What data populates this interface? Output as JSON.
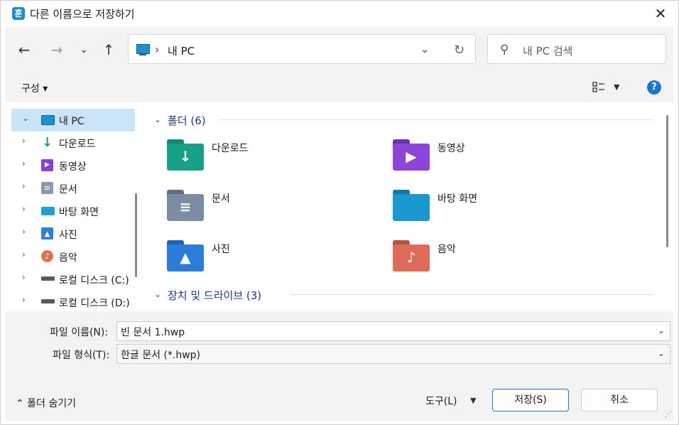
{
  "window": {
    "app_icon": "훈",
    "title": "다른 이름으로 저장하기",
    "close_glyph": "✕"
  },
  "nav": {
    "back": "←",
    "forward": "→",
    "recent": "⌄",
    "up": "↑",
    "address_sep": "›",
    "address": "내 PC",
    "address_dd": "⌄",
    "refresh": "↻",
    "search_placeholder": "내 PC 검색"
  },
  "toolbar": {
    "organize": "구성 ▾",
    "view_dd": "▼",
    "help": "?"
  },
  "tree": [
    {
      "label": "내 PC",
      "chev": "⌄",
      "icon": "pc-icon",
      "color": "#1e90cf",
      "selected": true
    },
    {
      "label": "다운로드",
      "chev": "›",
      "icon": "download-icon",
      "color": "#1aa37a"
    },
    {
      "label": "동영상",
      "chev": "›",
      "icon": "video-icon",
      "color": "#8a3fd6"
    },
    {
      "label": "문서",
      "chev": "›",
      "icon": "document-icon",
      "color": "#8a99ad"
    },
    {
      "label": "바탕 화면",
      "chev": "›",
      "icon": "desktop-icon",
      "color": "#1aa0d6"
    },
    {
      "label": "사진",
      "chev": "›",
      "icon": "photo-icon",
      "color": "#2f7dd6"
    },
    {
      "label": "음악",
      "chev": "›",
      "icon": "music-icon",
      "color": "#e0705a"
    },
    {
      "label": "로컬 디스크 (C:)",
      "chev": "›",
      "icon": "drive-c-icon",
      "color": "#5a5a5a"
    },
    {
      "label": "로컬 디스크 (D:)",
      "chev": "›",
      "icon": "drive-d-icon",
      "color": "#5a5a5a"
    }
  ],
  "groups": {
    "folders": {
      "label": "폴더 (6)"
    },
    "drives": {
      "label": "장치 및 드라이브 (3)"
    }
  },
  "folders": [
    {
      "label": "다운로드",
      "icon": "download-folder-icon",
      "color": "#17a085",
      "glyph": "↓"
    },
    {
      "label": "동영상",
      "icon": "video-folder-icon",
      "color": "#8e44d9",
      "glyph": "▶"
    },
    {
      "label": "문서",
      "icon": "document-folder-icon",
      "color": "#7b8ca3",
      "glyph": "≡"
    },
    {
      "label": "바탕 화면",
      "icon": "desktop-folder-icon",
      "color": "#1a98d0",
      "glyph": ""
    },
    {
      "label": "사진",
      "icon": "photo-folder-icon",
      "color": "#2c7cd8",
      "glyph": "▲"
    },
    {
      "label": "음악",
      "icon": "music-folder-icon",
      "color": "#de6a5a",
      "glyph": "♪"
    }
  ],
  "form": {
    "filename_label": "파일 이름(N):",
    "filename_value": "빈 문서 1.hwp",
    "filetype_label": "파일 형식(T):",
    "filetype_value": "한글 문서 (*.hwp)",
    "dd_glyph": "⌄"
  },
  "footer": {
    "hide_folders": "⌃ 폴더 숨기기",
    "tools": "도구(L)",
    "tools_dd": "▼",
    "save": "저장(S)",
    "cancel": "취소",
    "grip": "⋰"
  }
}
